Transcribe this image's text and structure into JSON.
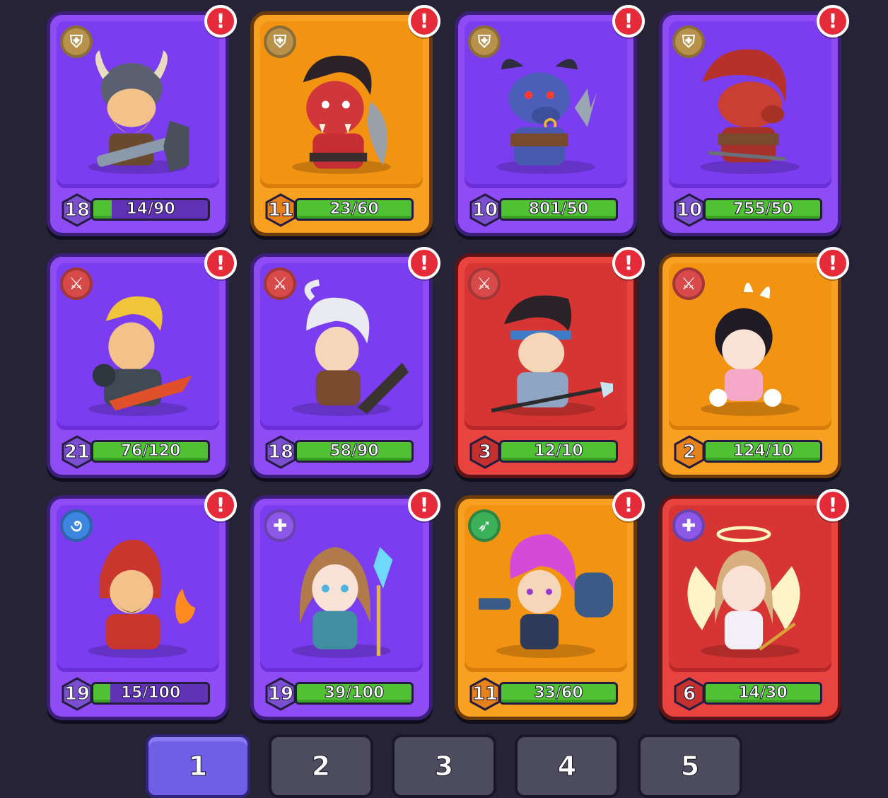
{
  "cards": [
    {
      "theme": "purple",
      "class_icon": "shield-icon",
      "class_glyph": "⛨",
      "level": "18",
      "progress": "14/90",
      "fill_pct": 16,
      "hero": "viking-dwarf",
      "alert": "!"
    },
    {
      "theme": "orange",
      "class_icon": "shield-icon",
      "class_glyph": "⛨",
      "level": "11",
      "progress": "23/60",
      "fill_pct": 100,
      "hero": "red-orc",
      "alert": "!"
    },
    {
      "theme": "purple",
      "class_icon": "shield-icon",
      "class_glyph": "⛨",
      "level": "10",
      "progress": "801/50",
      "fill_pct": 100,
      "hero": "blue-minotaur",
      "alert": "!"
    },
    {
      "theme": "purple",
      "class_icon": "shield-icon",
      "class_glyph": "⛨",
      "level": "10",
      "progress": "755/50",
      "fill_pct": 100,
      "hero": "red-boar",
      "alert": "!"
    },
    {
      "theme": "purple",
      "class_icon": "sword-icon",
      "class_glyph": "⚔",
      "level": "21",
      "progress": "76/120",
      "fill_pct": 100,
      "hero": "blond-knight",
      "alert": "!"
    },
    {
      "theme": "purple",
      "class_icon": "sword-icon",
      "class_glyph": "⚔",
      "level": "18",
      "progress": "58/90",
      "fill_pct": 100,
      "hero": "white-haired-warrior",
      "alert": "!"
    },
    {
      "theme": "red",
      "class_icon": "sword-icon",
      "class_glyph": "⚔",
      "level": "3",
      "progress": "12/10",
      "fill_pct": 100,
      "hero": "spear-general",
      "alert": "!"
    },
    {
      "theme": "orange",
      "class_icon": "sword-icon",
      "class_glyph": "⚔",
      "level": "2",
      "progress": "124/10",
      "fill_pct": 100,
      "hero": "bunny-girl",
      "alert": "!"
    },
    {
      "theme": "purple",
      "class_icon": "magic-icon",
      "class_glyph": "૭",
      "level": "19",
      "progress": "15/100",
      "fill_pct": 15,
      "hero": "fire-mage",
      "alert": "!"
    },
    {
      "theme": "purple",
      "class_icon": "heal-icon",
      "class_glyph": "✚",
      "level": "19",
      "progress": "39/100",
      "fill_pct": 100,
      "hero": "crystal-priestess",
      "alert": "!"
    },
    {
      "theme": "orange",
      "class_icon": "bow-icon",
      "class_glyph": "➶",
      "level": "11",
      "progress": "33/60",
      "fill_pct": 100,
      "hero": "pink-gunner",
      "alert": "!"
    },
    {
      "theme": "red",
      "class_icon": "heal-icon",
      "class_glyph": "✚",
      "level": "6",
      "progress": "14/30",
      "fill_pct": 100,
      "hero": "angel",
      "alert": "!"
    }
  ],
  "pages": [
    {
      "label": "1",
      "active": true
    },
    {
      "label": "2",
      "active": false
    },
    {
      "label": "3",
      "active": false
    },
    {
      "label": "4",
      "active": false
    },
    {
      "label": "5",
      "active": false
    }
  ],
  "colors": {
    "background": "#252335",
    "purple": "#8f4cf5",
    "orange": "#f7a021",
    "red": "#e8433f",
    "progress_green": "#4fc133",
    "alert_red": "#e52b3a",
    "page_active": "#6f5ee6",
    "page_inactive": "#4d4c5e"
  }
}
